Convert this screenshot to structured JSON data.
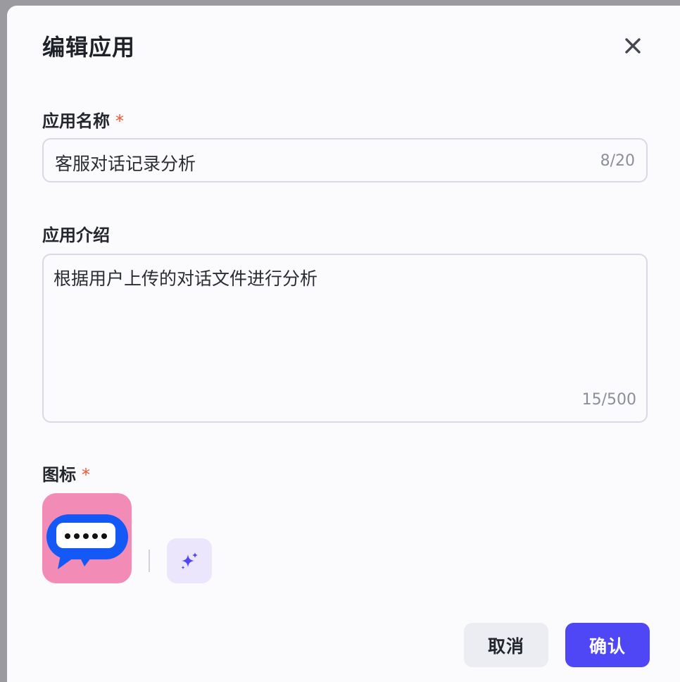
{
  "dialog": {
    "title": "编辑应用",
    "close_icon": "close-icon"
  },
  "name_field": {
    "label": "应用名称",
    "required_mark": "*",
    "value": "客服对话记录分析",
    "counter": "8/20"
  },
  "description_field": {
    "label": "应用介绍",
    "value": "根据用户上传的对话文件进行分析",
    "counter": "15/500"
  },
  "icon_field": {
    "label": "图标",
    "required_mark": "*",
    "current_icon": "chat-bubble-icon",
    "ai_generate_icon": "sparkle-icon",
    "colors": {
      "tile_background": "#f28bb5",
      "bubble": "#1459f5",
      "ai_button_background": "#ebe6fb",
      "sparkle": "#4f46f5"
    }
  },
  "footer": {
    "cancel_label": "取消",
    "confirm_label": "确认"
  },
  "colors": {
    "accent": "#4f46f5",
    "required": "#f0542c"
  }
}
